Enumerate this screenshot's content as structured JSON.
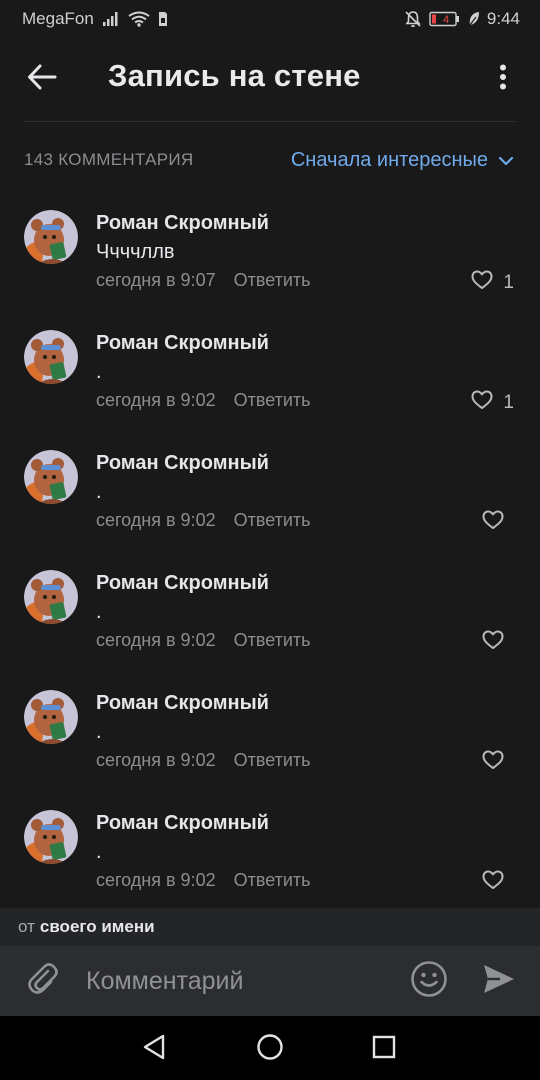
{
  "status_bar": {
    "carrier": "MegaFon",
    "battery_level": "4",
    "time": "9:44"
  },
  "header": {
    "title": "Запись на стене",
    "back_icon": "arrow-left-icon",
    "menu_icon": "more-vertical-icon"
  },
  "comments_section": {
    "count_label": "143 КОММЕНТАРИЯ",
    "sort_label": "Сначала интересные"
  },
  "comments": [
    {
      "author": "Роман Скромный",
      "text": "Ччччллв",
      "time": "сегодня в 9:07",
      "reply_label": "Ответить",
      "likes": "1"
    },
    {
      "author": "Роман Скромный",
      "text": ".",
      "time": "сегодня в 9:02",
      "reply_label": "Ответить",
      "likes": "1"
    },
    {
      "author": "Роман Скромный",
      "text": ".",
      "time": "сегодня в 9:02",
      "reply_label": "Ответить",
      "likes": ""
    },
    {
      "author": "Роман Скромный",
      "text": ".",
      "time": "сегодня в 9:02",
      "reply_label": "Ответить",
      "likes": ""
    },
    {
      "author": "Роман Скромный",
      "text": ".",
      "time": "сегодня в 9:02",
      "reply_label": "Ответить",
      "likes": ""
    },
    {
      "author": "Роман Скромный",
      "text": ".",
      "time": "сегодня в 9:02",
      "reply_label": "Ответить",
      "likes": ""
    }
  ],
  "sender": {
    "prefix": "от",
    "name": "своего имени"
  },
  "composer": {
    "placeholder": "Комментарий"
  },
  "colors": {
    "background": "#19191a",
    "accent": "#71aaeb",
    "secondary_text": "#8b8d91",
    "battery_low": "#e64646"
  }
}
